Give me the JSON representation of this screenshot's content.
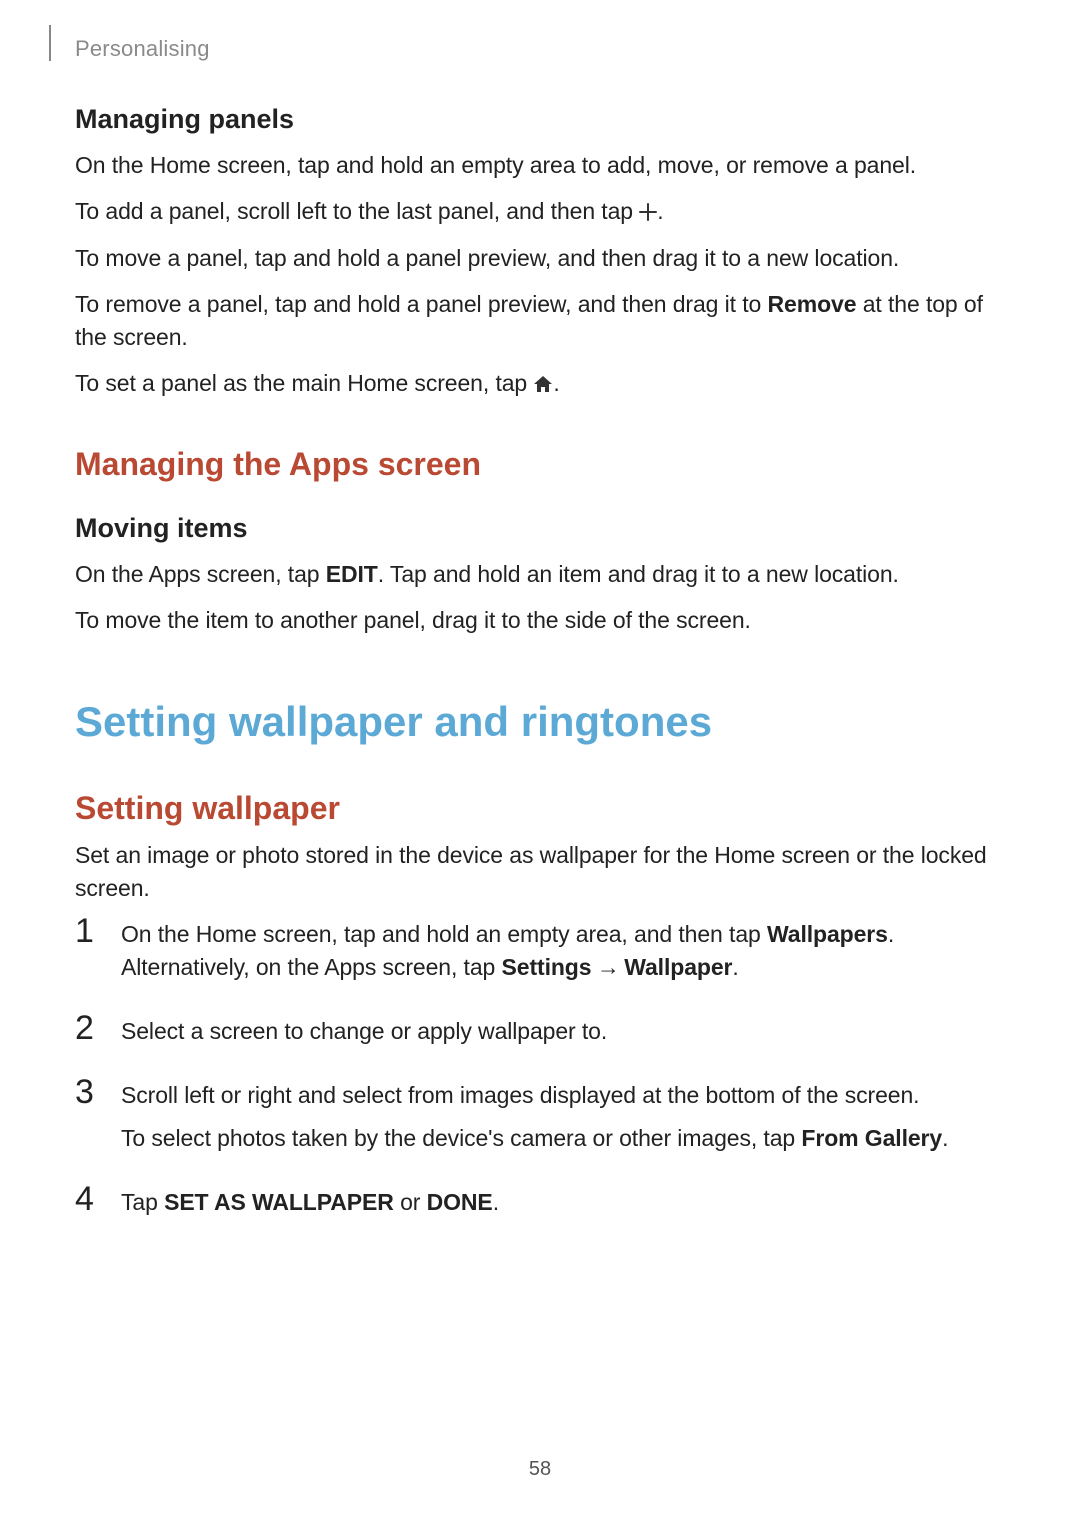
{
  "header": {
    "section": "Personalising"
  },
  "managing_panels": {
    "title": "Managing panels",
    "p1": "On the Home screen, tap and hold an empty area to add, move, or remove a panel.",
    "p2a": "To add a panel, scroll left to the last panel, and then tap ",
    "p2b": ".",
    "p3": "To move a panel, tap and hold a panel preview, and then drag it to a new location.",
    "p4a": "To remove a panel, tap and hold a panel preview, and then drag it to ",
    "p4_bold": "Remove",
    "p4b": " at the top of the screen.",
    "p5a": "To set a panel as the main Home screen, tap ",
    "p5b": "."
  },
  "managing_apps": {
    "title": "Managing the Apps screen"
  },
  "moving_items": {
    "title": "Moving items",
    "p1a": "On the Apps screen, tap ",
    "p1_bold": "EDIT",
    "p1b": ". Tap and hold an item and drag it to a new location.",
    "p2": "To move the item to another panel, drag it to the side of the screen."
  },
  "wallpaper_section": {
    "title": "Setting wallpaper and ringtones"
  },
  "setting_wallpaper": {
    "title": "Setting wallpaper",
    "intro": "Set an image or photo stored in the device as wallpaper for the Home screen or the locked screen.",
    "steps": {
      "n1": "1",
      "s1a": "On the Home screen, tap and hold an empty area, and then tap ",
      "s1_bold1": "Wallpapers",
      "s1b": ". Alternatively, on the Apps screen, tap ",
      "s1_bold2": "Settings",
      "s1_arrow": " → ",
      "s1_bold3": "Wallpaper",
      "s1c": ".",
      "n2": "2",
      "s2": "Select a screen to change or apply wallpaper to.",
      "n3": "3",
      "s3a": "Scroll left or right and select from images displayed at the bottom of the screen.",
      "s3b_a": "To select photos taken by the device's camera or other images, tap ",
      "s3b_bold": "From Gallery",
      "s3b_b": ".",
      "n4": "4",
      "s4a": "Tap ",
      "s4_bold1": "SET AS WALLPAPER",
      "s4b": " or ",
      "s4_bold2": "DONE",
      "s4c": "."
    }
  },
  "page_number": "58"
}
